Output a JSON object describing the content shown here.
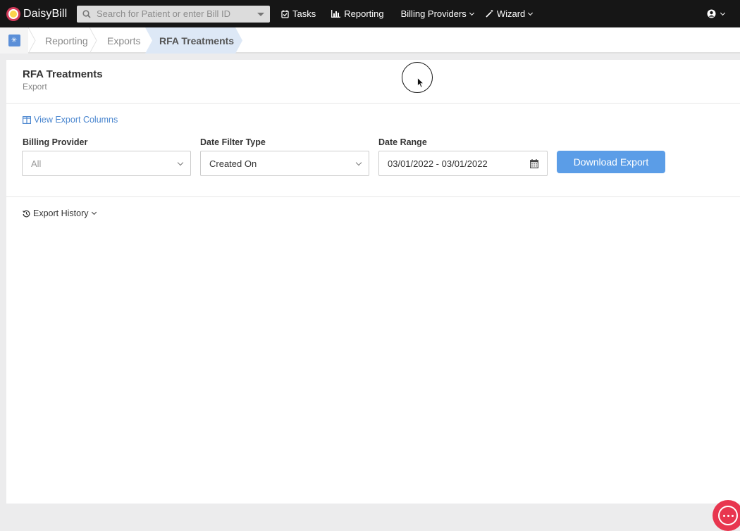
{
  "topbar": {
    "brand": "DaisyBill",
    "search_placeholder": "Search for Patient or enter Bill ID",
    "nav": {
      "tasks": "Tasks",
      "reporting": "Reporting",
      "billing_providers": "Billing Providers",
      "wizard": "Wizard"
    }
  },
  "breadcrumb": {
    "items": [
      "Reporting",
      "Exports"
    ],
    "active": "RFA Treatments"
  },
  "page": {
    "title": "RFA Treatments",
    "subtitle": "Export",
    "view_columns_link": "View Export Columns"
  },
  "form": {
    "billing_provider": {
      "label": "Billing Provider",
      "value": "All"
    },
    "date_filter_type": {
      "label": "Date Filter Type",
      "value": "Created On"
    },
    "date_range": {
      "label": "Date Range",
      "value": "03/01/2022 - 03/01/2022"
    },
    "download_label": "Download Export"
  },
  "history": {
    "label": "Export History"
  },
  "colors": {
    "accent": "#5b9de7",
    "link": "#4a86cf",
    "topbar": "#161616",
    "chat": "#e8364f"
  }
}
